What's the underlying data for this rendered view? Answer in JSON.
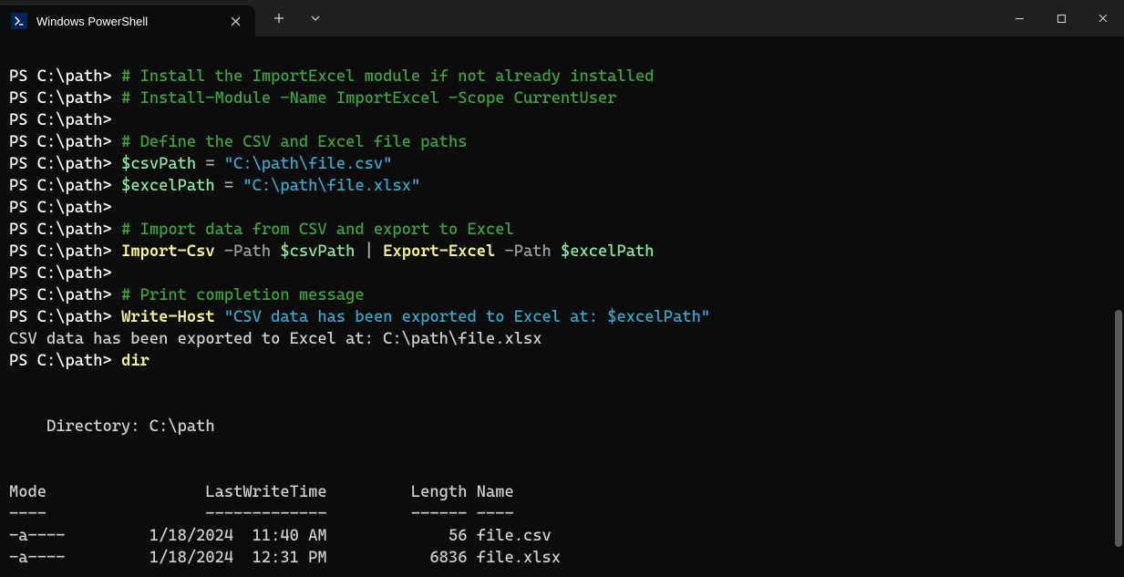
{
  "titlebar": {
    "tab_title": "Windows PowerShell"
  },
  "prompt": "PS C:\\path>",
  "lines": {
    "c1": "# Install the ImportExcel module if not already installed",
    "c2": "# Install-Module -Name ImportExcel -Scope CurrentUser",
    "c3": "# Define the CSV and Excel file paths",
    "v1": "$csvPath",
    "eq": " = ",
    "s1": "\"C:\\path\\file.csv\"",
    "v2": "$excelPath",
    "s2": "\"C:\\path\\file.xlsx\"",
    "c4": "# Import data from CSV and export to Excel",
    "cmd1": "Import-Csv",
    "p1": " -Path ",
    "pipe": " | ",
    "cmd2": "Export-Excel",
    "c5": "# Print completion message",
    "cmd3": "Write-Host",
    "s3": "\"CSV data has been exported to Excel at: $excelPath\"",
    "out1": "CSV data has been exported to Excel at: C:\\path\\file.xlsx",
    "cmd4": "dir",
    "dirhdr": "    Directory: C:\\path",
    "colhdr": "Mode                 LastWriteTime         Length Name",
    "coldash": "----                 -------------         ------ ----",
    "row1": "-a----         1/18/2024  11:40 AM             56 file.csv",
    "row2": "-a----         1/18/2024  12:31 PM           6836 file.xlsx"
  }
}
